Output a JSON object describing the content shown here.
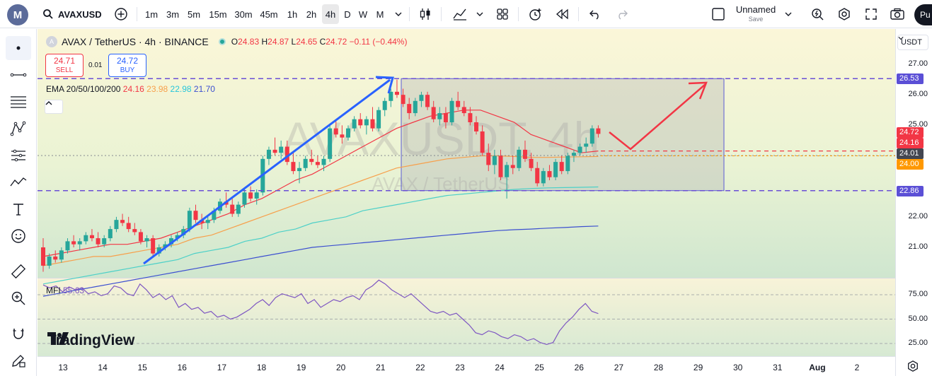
{
  "toolbar": {
    "symbol": "AVAXUSD",
    "intervals": [
      "1m",
      "3m",
      "5m",
      "15m",
      "30m",
      "45m",
      "1h",
      "2h",
      "4h",
      "D",
      "W",
      "M"
    ],
    "active_interval": "4h",
    "layout_name": "Unnamed",
    "layout_status": "Save",
    "publish_label": "Pu"
  },
  "legend": {
    "title": "AVAX / TetherUS · 4h · BINANCE",
    "ohlc": {
      "o_label": "O",
      "o": "24.83",
      "h_label": "H",
      "h": "24.87",
      "l_label": "L",
      "l": "24.65",
      "c_label": "C",
      "c": "24.72",
      "change": "−0.11 (−0.44%)"
    }
  },
  "trade": {
    "sell_price": "24.71",
    "sell_label": "SELL",
    "spread": "0.01",
    "buy_price": "24.72",
    "buy_label": "BUY"
  },
  "ema": {
    "label": "EMA 20/50/100/200",
    "v20": "24.16",
    "v50": "23.98",
    "v100": "22.98",
    "v200": "21.70"
  },
  "mfi": {
    "label": "MFI",
    "value": "55.63"
  },
  "watermark": {
    "main": "AVAXUSDT, 4h",
    "sub": "AVAX / TetherUS"
  },
  "branding": "TradingView",
  "currency": "USDT",
  "colors": {
    "up": "#26a69a",
    "down": "#f23645",
    "ema20": "#f23645",
    "ema50": "#f7a04c",
    "ema100": "#4dd0c8",
    "ema200": "#3c4fd0",
    "mfi": "#7e57c2",
    "box_border": "#5b5bd6",
    "dash_purple": "#6a4fd6"
  },
  "chart_data": {
    "type": "candlestick",
    "price_axis": {
      "ticks": [
        "27.00",
        "26.00",
        "25.00",
        "22.00",
        "21.00"
      ],
      "tags": [
        {
          "value": "26.53",
          "color": "#5b4fd6"
        },
        {
          "value": "24.72",
          "color": "#f23645"
        },
        {
          "value": "24.16",
          "color": "#f23645"
        },
        {
          "value": "24.01",
          "color": "#434651"
        },
        {
          "value": "24.00",
          "color": "#ff9800"
        },
        {
          "value": "22.86",
          "color": "#5b4fd6"
        }
      ],
      "range": [
        20.1,
        27.4
      ]
    },
    "mfi_axis": {
      "ticks": [
        "75.00",
        "50.00",
        "25.00"
      ],
      "range": [
        15,
        90
      ]
    },
    "time_axis": [
      "13",
      "14",
      "15",
      "16",
      "17",
      "18",
      "19",
      "20",
      "21",
      "22",
      "23",
      "24",
      "25",
      "26",
      "27",
      "28",
      "29",
      "30",
      "31",
      "Aug",
      "2"
    ],
    "levels": {
      "resistance": 26.53,
      "support": 22.86,
      "mid_red": 24.16
    },
    "candles": [
      [
        21.0,
        21.3,
        20.2,
        20.4
      ],
      [
        20.4,
        20.8,
        20.3,
        20.7
      ],
      [
        20.7,
        20.9,
        20.5,
        20.6
      ],
      [
        20.6,
        21.0,
        20.5,
        20.9
      ],
      [
        20.9,
        21.3,
        20.8,
        21.2
      ],
      [
        21.2,
        21.4,
        21.0,
        21.1
      ],
      [
        21.1,
        21.3,
        20.9,
        21.2
      ],
      [
        21.2,
        21.5,
        21.1,
        21.4
      ],
      [
        21.4,
        21.6,
        21.2,
        21.3
      ],
      [
        21.3,
        21.5,
        21.0,
        21.1
      ],
      [
        21.1,
        21.4,
        21.0,
        21.3
      ],
      [
        21.3,
        21.7,
        21.2,
        21.6
      ],
      [
        21.6,
        22.0,
        21.5,
        21.9
      ],
      [
        21.9,
        22.1,
        21.7,
        21.8
      ],
      [
        21.8,
        22.0,
        21.5,
        21.6
      ],
      [
        21.6,
        21.8,
        21.4,
        21.5
      ],
      [
        21.5,
        21.6,
        21.1,
        21.2
      ],
      [
        21.2,
        21.4,
        21.0,
        21.3
      ],
      [
        21.3,
        21.4,
        20.7,
        20.8
      ],
      [
        20.8,
        21.1,
        20.7,
        21.0
      ],
      [
        21.0,
        21.2,
        20.9,
        21.1
      ],
      [
        21.1,
        21.4,
        21.0,
        21.3
      ],
      [
        21.3,
        21.5,
        21.2,
        21.4
      ],
      [
        21.4,
        21.7,
        21.3,
        21.6
      ],
      [
        21.6,
        22.3,
        21.5,
        22.2
      ],
      [
        22.2,
        22.4,
        21.8,
        21.9
      ],
      [
        21.9,
        22.1,
        21.6,
        21.8
      ],
      [
        21.8,
        22.0,
        21.6,
        21.9
      ],
      [
        21.9,
        22.3,
        21.8,
        22.2
      ],
      [
        22.2,
        22.6,
        22.1,
        22.5
      ],
      [
        22.5,
        22.8,
        22.3,
        22.4
      ],
      [
        22.4,
        22.6,
        22.0,
        22.1
      ],
      [
        22.1,
        22.5,
        22.0,
        22.4
      ],
      [
        22.4,
        22.9,
        22.3,
        22.8
      ],
      [
        22.8,
        23.0,
        22.5,
        22.6
      ],
      [
        22.6,
        22.9,
        22.4,
        22.8
      ],
      [
        22.8,
        24.0,
        22.7,
        23.9
      ],
      [
        23.9,
        24.3,
        23.7,
        24.2
      ],
      [
        24.2,
        24.6,
        24.0,
        24.1
      ],
      [
        24.1,
        24.5,
        23.9,
        24.3
      ],
      [
        24.3,
        24.5,
        23.7,
        23.8
      ],
      [
        23.8,
        24.1,
        23.4,
        23.5
      ],
      [
        23.5,
        23.8,
        23.1,
        23.6
      ],
      [
        23.6,
        24.0,
        23.5,
        23.9
      ],
      [
        23.9,
        24.2,
        23.7,
        23.8
      ],
      [
        23.8,
        24.0,
        23.6,
        23.7
      ],
      [
        23.7,
        24.0,
        23.5,
        23.9
      ],
      [
        23.9,
        25.0,
        23.8,
        24.9
      ],
      [
        24.9,
        25.2,
        24.6,
        24.7
      ],
      [
        24.7,
        25.0,
        24.4,
        24.6
      ],
      [
        24.6,
        25.0,
        24.5,
        24.9
      ],
      [
        24.9,
        25.3,
        24.8,
        25.2
      ],
      [
        25.2,
        25.4,
        24.9,
        25.0
      ],
      [
        25.0,
        25.3,
        24.7,
        25.2
      ],
      [
        25.2,
        25.6,
        24.8,
        24.9
      ],
      [
        24.9,
        25.6,
        24.8,
        25.5
      ],
      [
        25.5,
        25.9,
        25.3,
        25.8
      ],
      [
        25.8,
        26.2,
        25.6,
        26.1
      ],
      [
        26.1,
        26.5,
        25.9,
        26.0
      ],
      [
        26.0,
        26.2,
        25.6,
        25.7
      ],
      [
        25.7,
        25.9,
        25.2,
        25.4
      ],
      [
        25.4,
        25.9,
        25.3,
        25.8
      ],
      [
        25.8,
        26.1,
        25.6,
        26.0
      ],
      [
        26.0,
        26.1,
        25.5,
        25.6
      ],
      [
        25.6,
        25.8,
        25.1,
        25.2
      ],
      [
        25.2,
        25.6,
        25.0,
        25.4
      ],
      [
        25.4,
        25.6,
        24.9,
        25.1
      ],
      [
        25.1,
        25.9,
        25.0,
        25.8
      ],
      [
        25.8,
        26.1,
        25.5,
        25.6
      ],
      [
        25.6,
        25.8,
        25.3,
        25.4
      ],
      [
        25.4,
        25.6,
        25.0,
        25.1
      ],
      [
        25.1,
        25.3,
        24.7,
        24.8
      ],
      [
        24.8,
        25.0,
        24.0,
        24.1
      ],
      [
        24.1,
        24.4,
        23.5,
        23.7
      ],
      [
        23.7,
        24.2,
        23.4,
        24.0
      ],
      [
        24.0,
        24.2,
        23.2,
        23.3
      ],
      [
        23.3,
        23.8,
        22.6,
        23.7
      ],
      [
        23.7,
        24.0,
        23.4,
        23.6
      ],
      [
        23.6,
        24.3,
        23.5,
        24.2
      ],
      [
        24.2,
        24.5,
        23.8,
        23.9
      ],
      [
        23.9,
        24.1,
        23.5,
        23.6
      ],
      [
        23.6,
        23.8,
        23.0,
        23.1
      ],
      [
        23.1,
        23.6,
        23.0,
        23.5
      ],
      [
        23.5,
        23.7,
        23.2,
        23.3
      ],
      [
        23.3,
        23.9,
        23.2,
        23.8
      ],
      [
        23.8,
        24.0,
        23.4,
        23.5
      ],
      [
        23.5,
        24.1,
        23.4,
        24.0
      ],
      [
        24.0,
        24.2,
        23.8,
        24.1
      ],
      [
        24.1,
        24.4,
        24.0,
        24.3
      ],
      [
        24.3,
        24.6,
        24.1,
        24.4
      ],
      [
        24.4,
        25.0,
        24.3,
        24.9
      ],
      [
        24.9,
        25.0,
        24.6,
        24.72
      ]
    ],
    "ema20": [
      20.7,
      20.8,
      20.9,
      21.0,
      21.1,
      21.1,
      21.2,
      21.3,
      21.5,
      21.7,
      21.9,
      22.1,
      22.4,
      22.6,
      22.9,
      23.2,
      23.4,
      23.7,
      24.0,
      24.3,
      24.6,
      24.9,
      25.1,
      25.3,
      25.4,
      25.5,
      25.5,
      25.3,
      25.1,
      24.7,
      24.5,
      24.3,
      24.1,
      24.16
    ],
    "ema50": [
      20.4,
      20.5,
      20.6,
      20.7,
      20.7,
      20.8,
      20.9,
      21.0,
      21.1,
      21.3,
      21.4,
      21.6,
      21.8,
      22.0,
      22.2,
      22.4,
      22.6,
      22.8,
      23.0,
      23.2,
      23.4,
      23.6,
      23.7,
      23.8,
      23.9,
      23.95,
      24.0,
      24.0,
      23.98,
      23.95,
      23.95,
      23.96,
      23.97,
      23.98
    ],
    "ema100": [
      19.8,
      19.9,
      20.0,
      20.1,
      20.2,
      20.3,
      20.4,
      20.5,
      20.6,
      20.8,
      20.9,
      21.0,
      21.2,
      21.3,
      21.5,
      21.6,
      21.8,
      21.9,
      22.0,
      22.2,
      22.3,
      22.4,
      22.5,
      22.6,
      22.7,
      22.75,
      22.8,
      22.85,
      22.9,
      22.93,
      22.95,
      22.96,
      22.97,
      22.98
    ],
    "ema200": [
      19.4,
      19.5,
      19.6,
      19.7,
      19.8,
      19.9,
      20.0,
      20.1,
      20.2,
      20.3,
      20.4,
      20.5,
      20.6,
      20.7,
      20.8,
      20.9,
      21.0,
      21.05,
      21.1,
      21.15,
      21.2,
      21.25,
      21.3,
      21.35,
      21.4,
      21.45,
      21.5,
      21.55,
      21.58,
      21.6,
      21.63,
      21.65,
      21.68,
      21.7
    ],
    "mfi": [
      85,
      82,
      84,
      78,
      83,
      80,
      82,
      76,
      78,
      74,
      76,
      84,
      82,
      76,
      74,
      86,
      80,
      72,
      76,
      70,
      74,
      62,
      66,
      60,
      62,
      56,
      58,
      52,
      54,
      50,
      52,
      56,
      60,
      66,
      70,
      64,
      72,
      76,
      74,
      72,
      76,
      66,
      70,
      62,
      66,
      70,
      68,
      72,
      74,
      70,
      80,
      84,
      90,
      86,
      80,
      76,
      72,
      76,
      70,
      64,
      58,
      56,
      58,
      54,
      56,
      50,
      44,
      36,
      34,
      38,
      36,
      32,
      30,
      34,
      32,
      28,
      30,
      26,
      24,
      26,
      38,
      46,
      52,
      60,
      66,
      58,
      55.63
    ]
  },
  "drawings": {
    "up_arrow": "blue trend arrow",
    "range_box": "rectangle",
    "projection": "red zigzag arrow"
  }
}
